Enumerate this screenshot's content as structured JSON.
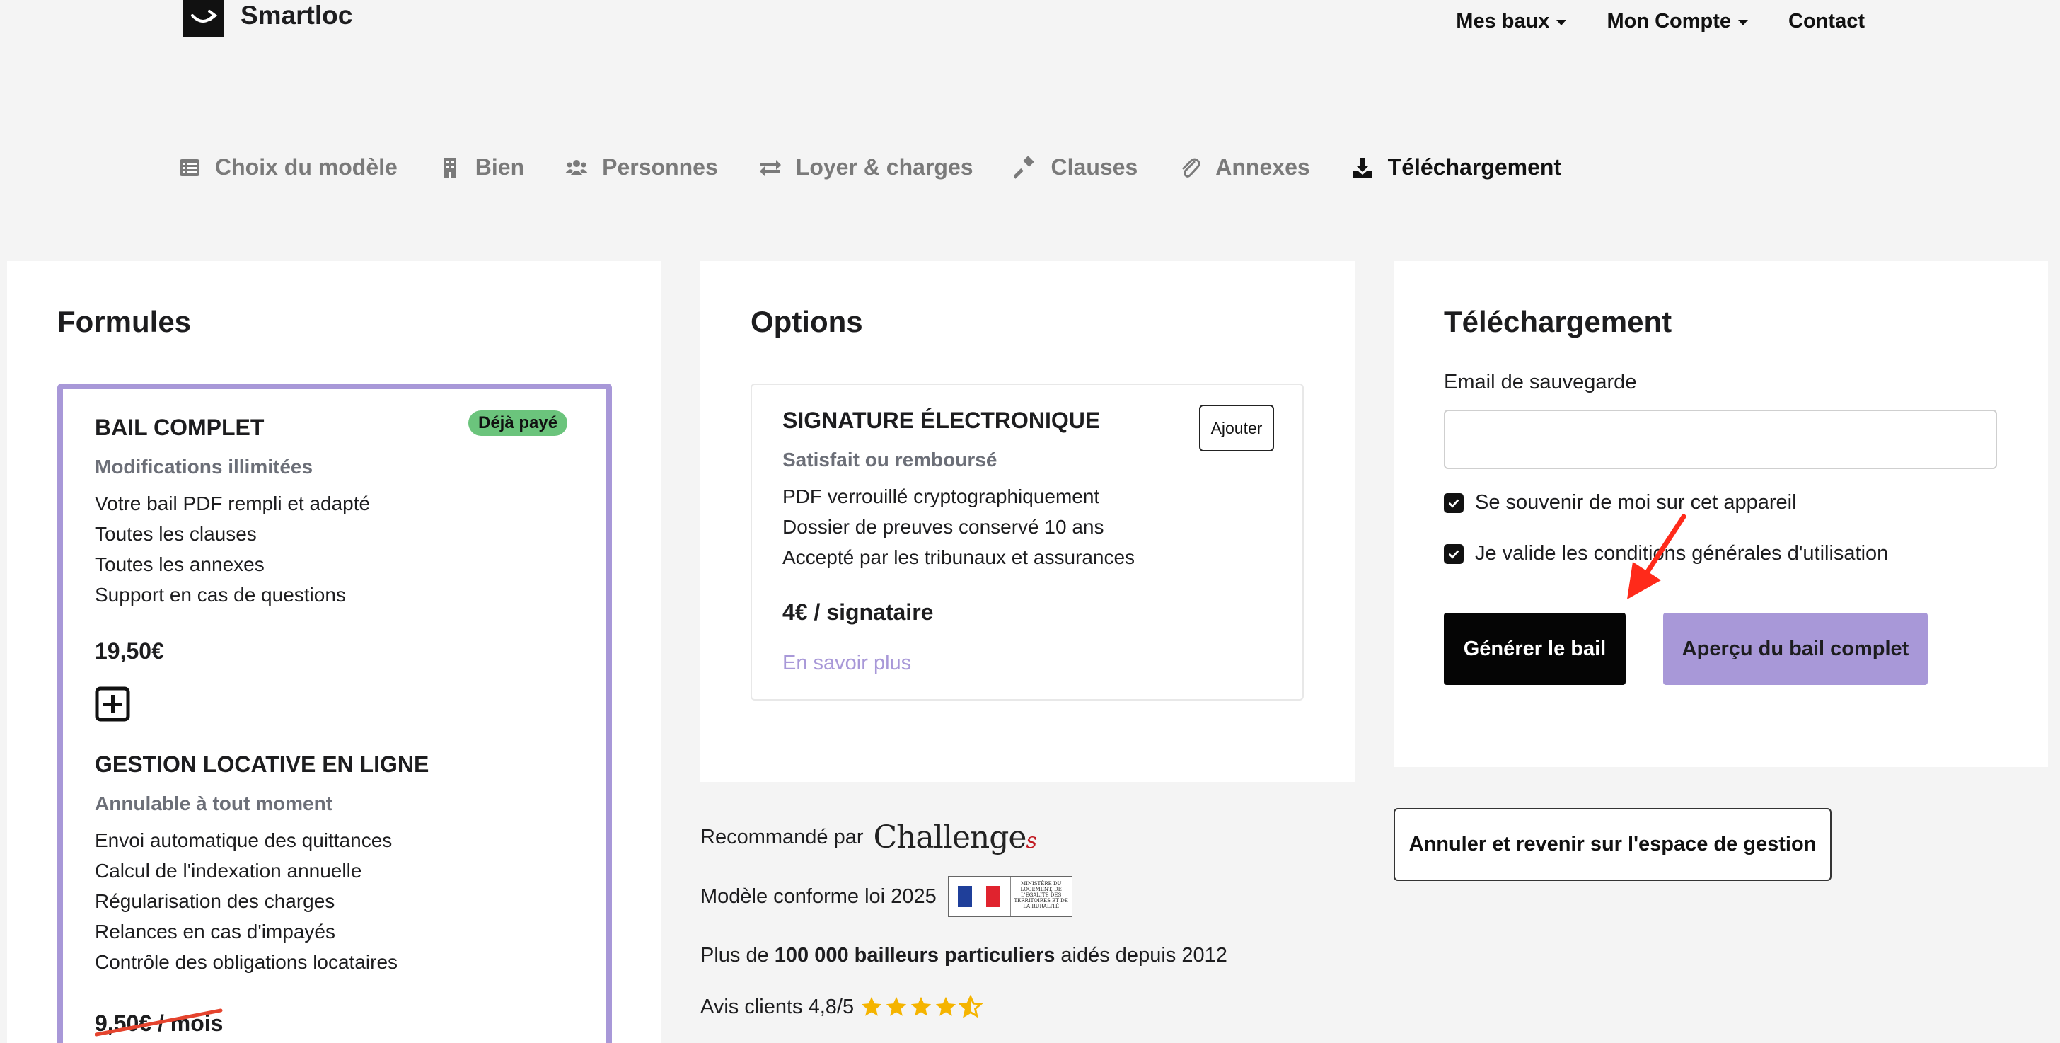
{
  "brand": {
    "name": "Smartloc"
  },
  "nav": {
    "mes_baux": "Mes baux",
    "mon_compte": "Mon Compte",
    "contact": "Contact"
  },
  "steps": [
    {
      "label": "Choix du modèle",
      "icon": "list-icon"
    },
    {
      "label": "Bien",
      "icon": "building-icon"
    },
    {
      "label": "Personnes",
      "icon": "users-icon"
    },
    {
      "label": "Loyer & charges",
      "icon": "exchange-icon"
    },
    {
      "label": "Clauses",
      "icon": "gavel-icon"
    },
    {
      "label": "Annexes",
      "icon": "paperclip-icon"
    },
    {
      "label": "Téléchargement",
      "icon": "download-icon",
      "active": true
    }
  ],
  "formules": {
    "title": "Formules",
    "bail": {
      "name": "BAIL COMPLET",
      "badge": "Déjà payé",
      "subtitle": "Modifications illimitées",
      "features": [
        "Votre bail PDF rempli et adapté",
        "Toutes les clauses",
        "Toutes les annexes",
        "Support en cas de questions"
      ],
      "price": "19,50€"
    },
    "gestion": {
      "name": "GESTION LOCATIVE EN LIGNE",
      "subtitle": "Annulable à tout moment",
      "features": [
        "Envoi automatique des quittances",
        "Calcul de l'indexation annuelle",
        "Régularisation des charges",
        "Relances en cas d'impayés",
        "Contrôle des obligations locataires"
      ],
      "price_old": "9,50€ / mois"
    }
  },
  "options": {
    "title": "Options",
    "signature": {
      "name": "SIGNATURE ÉLECTRONIQUE",
      "subtitle": "Satisfait ou remboursé",
      "add_label": "Ajouter",
      "features": [
        "PDF verrouillé cryptographiquement",
        "Dossier de preuves conservé 10 ans",
        "Accepté par les tribunaux et assurances"
      ],
      "price": "4€ / signataire",
      "more_link": "En savoir plus"
    }
  },
  "download": {
    "title": "Téléchargement",
    "email_label": "Email de sauvegarde",
    "email_value": "",
    "remember_label": "Se souvenir de moi sur cet appareil",
    "terms_label": "Je valide les conditions générales d'utilisation",
    "generate_label": "Générer le bail",
    "preview_label": "Aperçu du bail complet",
    "cancel_label": "Annuler et revenir sur l'espace de gestion"
  },
  "trust": {
    "recommended_prefix": "Recommandé par",
    "recommended_brand": "Challenge",
    "recommended_brand_suffix": "s",
    "conforme": "Modèle conforme loi 2025",
    "ministry_text": "MINISTÈRE DU LOGEMENT, DE L'ÉGALITÉ DES TERRITOIRES ET DE LA RURALITÉ",
    "bailleurs_prefix": "Plus de",
    "bailleurs_bold": "100 000 bailleurs particuliers",
    "bailleurs_suffix": "aidés depuis 2012",
    "avis": "Avis clients 4,8/5",
    "rating": 4.8
  },
  "colors": {
    "purple": "#a898d8",
    "green_badge": "#6bc47c",
    "star": "#f5b400",
    "arrow": "#ff2a1a"
  }
}
